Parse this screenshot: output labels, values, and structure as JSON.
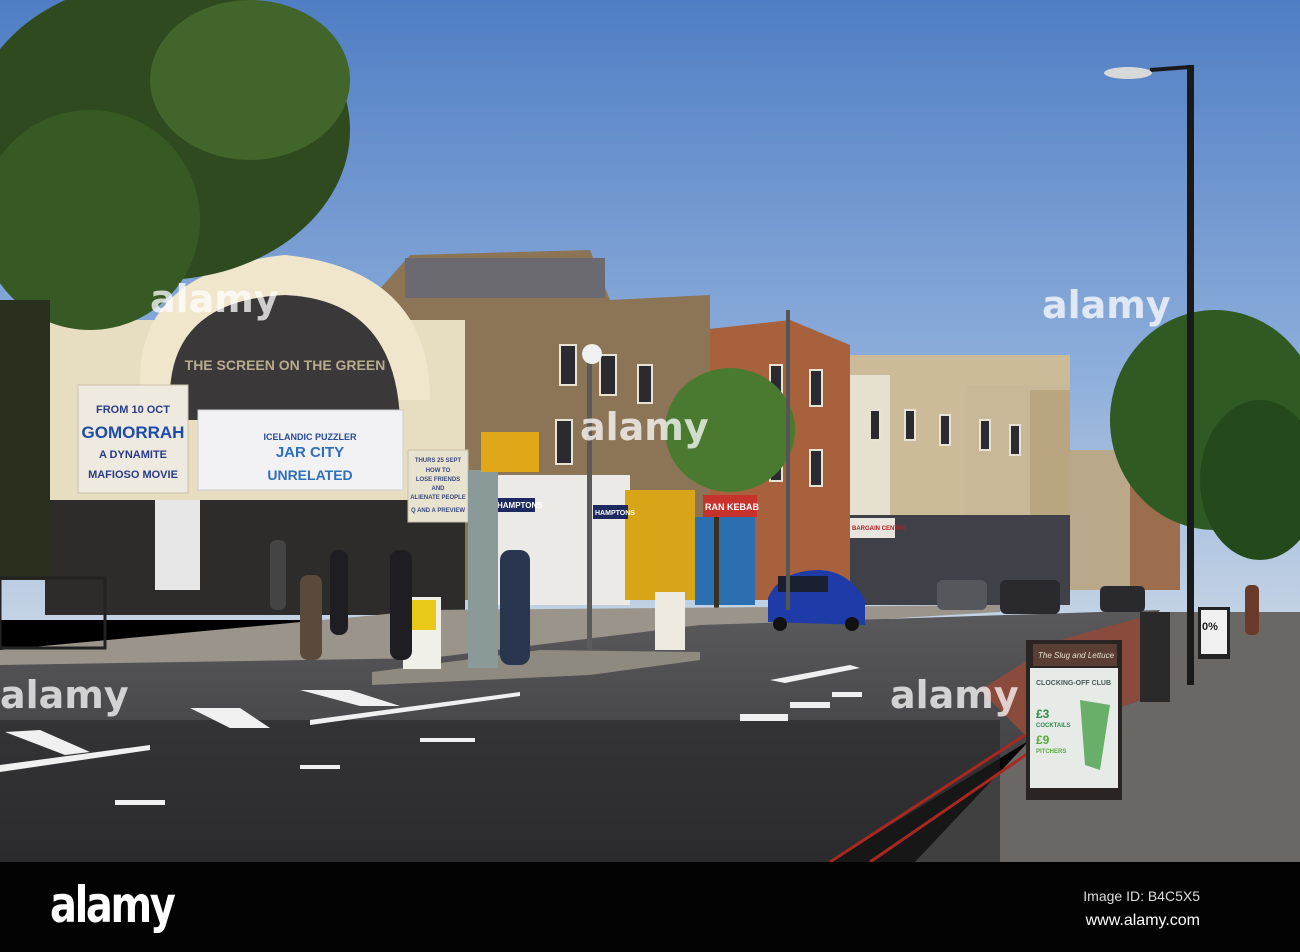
{
  "scene": {
    "cinema_name": "THE SCREEN ON THE GREEN",
    "marquee_left": {
      "line1": "FROM 10 OCT",
      "line2": "GOMORRAH",
      "line3": "A DYNAMITE",
      "line4": "MAFIOSO MOVIE"
    },
    "marquee_center": {
      "line1": "ICELANDIC PUZZLER",
      "line2": "JAR CITY",
      "line3": "UNRELATED"
    },
    "marquee_right": {
      "line1": "THURS 25 SEPT",
      "line2": "HOW TO",
      "line3": "LOSE FRIENDS",
      "line4": "AND",
      "line5": "ALIENATE PEOPLE",
      "line6": "Q AND A PREVIEW"
    },
    "shop_signs": [
      "HAMPTONS",
      "HAMPTONS",
      "RAN KEBAB",
      "BARGAIN CENTRE"
    ],
    "a_board": {
      "header": "The Slug and Lettuce",
      "title": "CLOCKING-OFF CLUB",
      "offer1_price": "£3",
      "offer1_item": "COCKTAILS",
      "offer2_price": "£9",
      "offer2_item": "PITCHERS"
    },
    "right_board": "0%"
  },
  "watermark": "alamy",
  "footer": {
    "logo": "alamy",
    "image_id": "Image ID: B4C5X5",
    "site": "www.alamy.com"
  }
}
